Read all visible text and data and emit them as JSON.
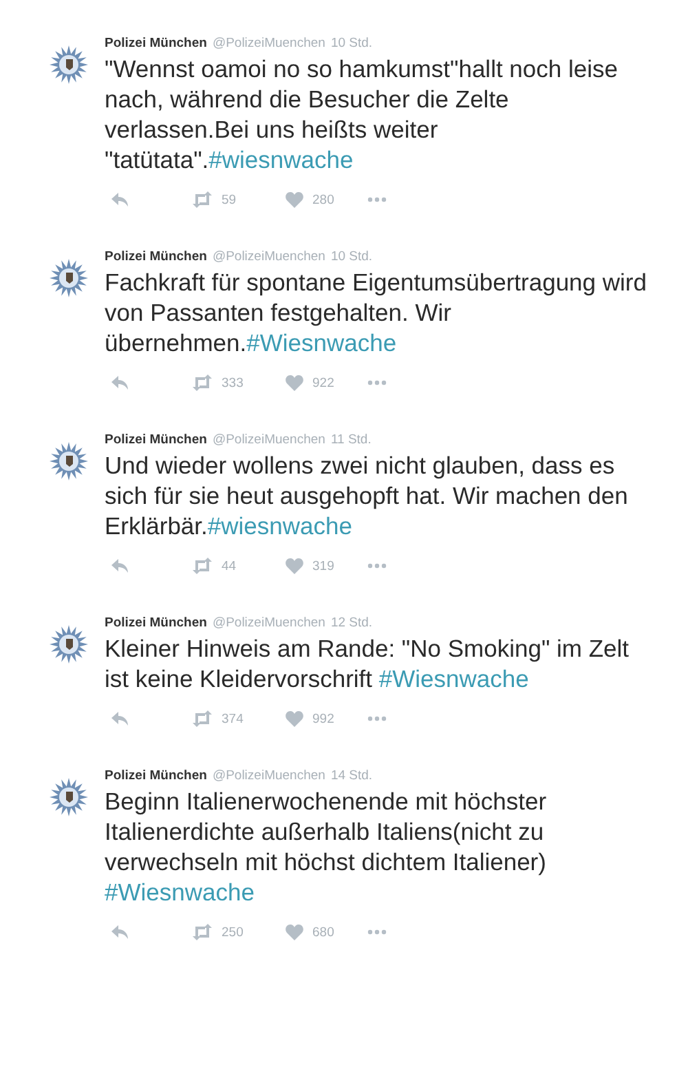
{
  "tweets": [
    {
      "name": "Polizei München",
      "handle": "@PolizeiMuenchen",
      "time": "10 Std.",
      "text": "\"Wennst oamoi no so hamkumst\"hallt noch leise nach, während die Besucher die Zelte verlassen.Bei uns heißts weiter \"tatütata\".",
      "hashtag": "#wiesnwache",
      "retweets": "59",
      "likes": "280"
    },
    {
      "name": "Polizei München",
      "handle": "@PolizeiMuenchen",
      "time": "10 Std.",
      "text": "Fachkraft für spontane Eigentumsübertragung wird von Passanten festgehalten. Wir übernehmen.",
      "hashtag": "#Wiesnwache",
      "retweets": "333",
      "likes": "922"
    },
    {
      "name": "Polizei München",
      "handle": "@PolizeiMuenchen",
      "time": "11 Std.",
      "text": "Und wieder wollens zwei nicht glauben, dass es sich für sie heut ausgehopft hat. Wir machen den Erklärbär.",
      "hashtag": "#wiesnwache",
      "retweets": "44",
      "likes": "319"
    },
    {
      "name": "Polizei München",
      "handle": "@PolizeiMuenchen",
      "time": "12 Std.",
      "text": "Kleiner Hinweis am Rande: \"No Smoking\" im Zelt ist keine Kleidervorschrift",
      "hashtag": "#Wiesnwache",
      "retweets": "374",
      "likes": "992"
    },
    {
      "name": "Polizei München",
      "handle": "@PolizeiMuenchen",
      "time": "14 Std.",
      "text": "Beginn Italienerwochenende mit höchster Italienerdichte außerhalb Italiens(nicht zu verwechseln mit höchst dichtem Italiener)",
      "hashtag": "#Wiesnwache",
      "retweets": "250",
      "likes": "680"
    }
  ]
}
